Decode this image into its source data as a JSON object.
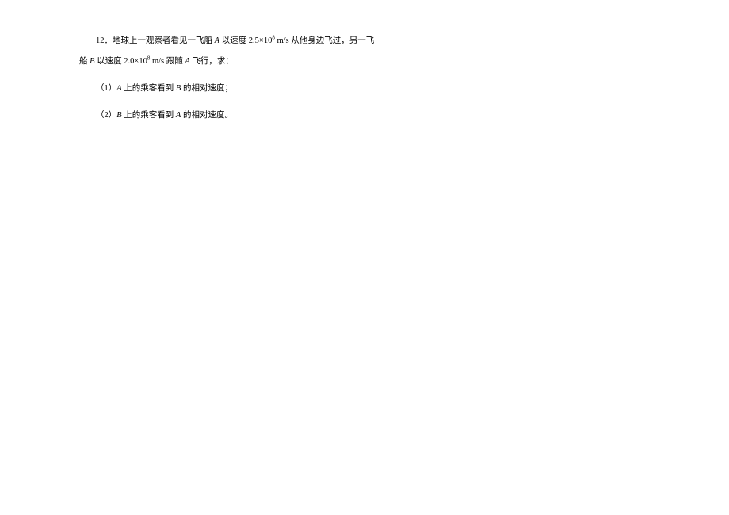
{
  "problem": {
    "number": "12．",
    "line1_prefix": "地球上一观察者看见一飞船 ",
    "varA": "A",
    "line1_mid1": " 以速度 2.5×10",
    "exp": "8",
    "line1_mid2": " m/s 从他身边飞过，另一飞",
    "line2_prefix": "船 ",
    "varB": "B",
    "line2_mid1": " 以速度 2.0×10",
    "line2_mid2": " m/s  跟随 ",
    "line2_suffix": " 飞行，求："
  },
  "sub1": {
    "label": "（1）",
    "prefix": "",
    "varA": "A",
    "mid": " 上的乘客看到 ",
    "varB": "B",
    "suffix": " 的相对速度；"
  },
  "sub2": {
    "label": "（2）",
    "prefix": "",
    "varB": "B",
    "mid": " 上的乘客看到 ",
    "varA": "A",
    "suffix": " 的相对速度。"
  }
}
